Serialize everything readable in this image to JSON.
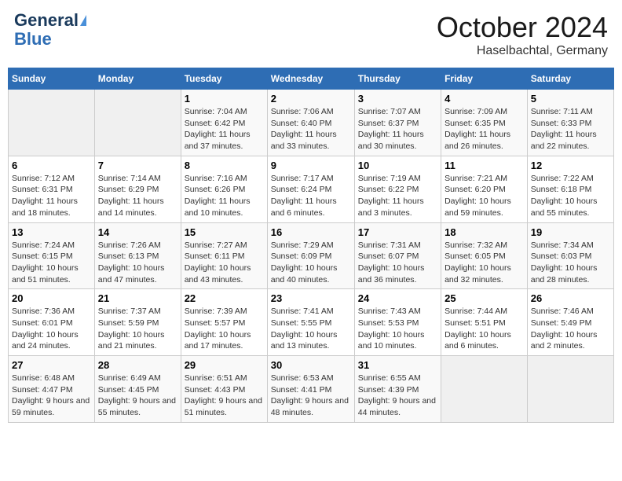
{
  "header": {
    "logo_line1": "General",
    "logo_line2": "Blue",
    "month": "October 2024",
    "location": "Haselbachtal, Germany"
  },
  "days_of_week": [
    "Sunday",
    "Monday",
    "Tuesday",
    "Wednesday",
    "Thursday",
    "Friday",
    "Saturday"
  ],
  "weeks": [
    [
      {
        "day": "",
        "info": ""
      },
      {
        "day": "",
        "info": ""
      },
      {
        "day": "1",
        "info": "Sunrise: 7:04 AM\nSunset: 6:42 PM\nDaylight: 11 hours and 37 minutes."
      },
      {
        "day": "2",
        "info": "Sunrise: 7:06 AM\nSunset: 6:40 PM\nDaylight: 11 hours and 33 minutes."
      },
      {
        "day": "3",
        "info": "Sunrise: 7:07 AM\nSunset: 6:37 PM\nDaylight: 11 hours and 30 minutes."
      },
      {
        "day": "4",
        "info": "Sunrise: 7:09 AM\nSunset: 6:35 PM\nDaylight: 11 hours and 26 minutes."
      },
      {
        "day": "5",
        "info": "Sunrise: 7:11 AM\nSunset: 6:33 PM\nDaylight: 11 hours and 22 minutes."
      }
    ],
    [
      {
        "day": "6",
        "info": "Sunrise: 7:12 AM\nSunset: 6:31 PM\nDaylight: 11 hours and 18 minutes."
      },
      {
        "day": "7",
        "info": "Sunrise: 7:14 AM\nSunset: 6:29 PM\nDaylight: 11 hours and 14 minutes."
      },
      {
        "day": "8",
        "info": "Sunrise: 7:16 AM\nSunset: 6:26 PM\nDaylight: 11 hours and 10 minutes."
      },
      {
        "day": "9",
        "info": "Sunrise: 7:17 AM\nSunset: 6:24 PM\nDaylight: 11 hours and 6 minutes."
      },
      {
        "day": "10",
        "info": "Sunrise: 7:19 AM\nSunset: 6:22 PM\nDaylight: 11 hours and 3 minutes."
      },
      {
        "day": "11",
        "info": "Sunrise: 7:21 AM\nSunset: 6:20 PM\nDaylight: 10 hours and 59 minutes."
      },
      {
        "day": "12",
        "info": "Sunrise: 7:22 AM\nSunset: 6:18 PM\nDaylight: 10 hours and 55 minutes."
      }
    ],
    [
      {
        "day": "13",
        "info": "Sunrise: 7:24 AM\nSunset: 6:15 PM\nDaylight: 10 hours and 51 minutes."
      },
      {
        "day": "14",
        "info": "Sunrise: 7:26 AM\nSunset: 6:13 PM\nDaylight: 10 hours and 47 minutes."
      },
      {
        "day": "15",
        "info": "Sunrise: 7:27 AM\nSunset: 6:11 PM\nDaylight: 10 hours and 43 minutes."
      },
      {
        "day": "16",
        "info": "Sunrise: 7:29 AM\nSunset: 6:09 PM\nDaylight: 10 hours and 40 minutes."
      },
      {
        "day": "17",
        "info": "Sunrise: 7:31 AM\nSunset: 6:07 PM\nDaylight: 10 hours and 36 minutes."
      },
      {
        "day": "18",
        "info": "Sunrise: 7:32 AM\nSunset: 6:05 PM\nDaylight: 10 hours and 32 minutes."
      },
      {
        "day": "19",
        "info": "Sunrise: 7:34 AM\nSunset: 6:03 PM\nDaylight: 10 hours and 28 minutes."
      }
    ],
    [
      {
        "day": "20",
        "info": "Sunrise: 7:36 AM\nSunset: 6:01 PM\nDaylight: 10 hours and 24 minutes."
      },
      {
        "day": "21",
        "info": "Sunrise: 7:37 AM\nSunset: 5:59 PM\nDaylight: 10 hours and 21 minutes."
      },
      {
        "day": "22",
        "info": "Sunrise: 7:39 AM\nSunset: 5:57 PM\nDaylight: 10 hours and 17 minutes."
      },
      {
        "day": "23",
        "info": "Sunrise: 7:41 AM\nSunset: 5:55 PM\nDaylight: 10 hours and 13 minutes."
      },
      {
        "day": "24",
        "info": "Sunrise: 7:43 AM\nSunset: 5:53 PM\nDaylight: 10 hours and 10 minutes."
      },
      {
        "day": "25",
        "info": "Sunrise: 7:44 AM\nSunset: 5:51 PM\nDaylight: 10 hours and 6 minutes."
      },
      {
        "day": "26",
        "info": "Sunrise: 7:46 AM\nSunset: 5:49 PM\nDaylight: 10 hours and 2 minutes."
      }
    ],
    [
      {
        "day": "27",
        "info": "Sunrise: 6:48 AM\nSunset: 4:47 PM\nDaylight: 9 hours and 59 minutes."
      },
      {
        "day": "28",
        "info": "Sunrise: 6:49 AM\nSunset: 4:45 PM\nDaylight: 9 hours and 55 minutes."
      },
      {
        "day": "29",
        "info": "Sunrise: 6:51 AM\nSunset: 4:43 PM\nDaylight: 9 hours and 51 minutes."
      },
      {
        "day": "30",
        "info": "Sunrise: 6:53 AM\nSunset: 4:41 PM\nDaylight: 9 hours and 48 minutes."
      },
      {
        "day": "31",
        "info": "Sunrise: 6:55 AM\nSunset: 4:39 PM\nDaylight: 9 hours and 44 minutes."
      },
      {
        "day": "",
        "info": ""
      },
      {
        "day": "",
        "info": ""
      }
    ]
  ]
}
